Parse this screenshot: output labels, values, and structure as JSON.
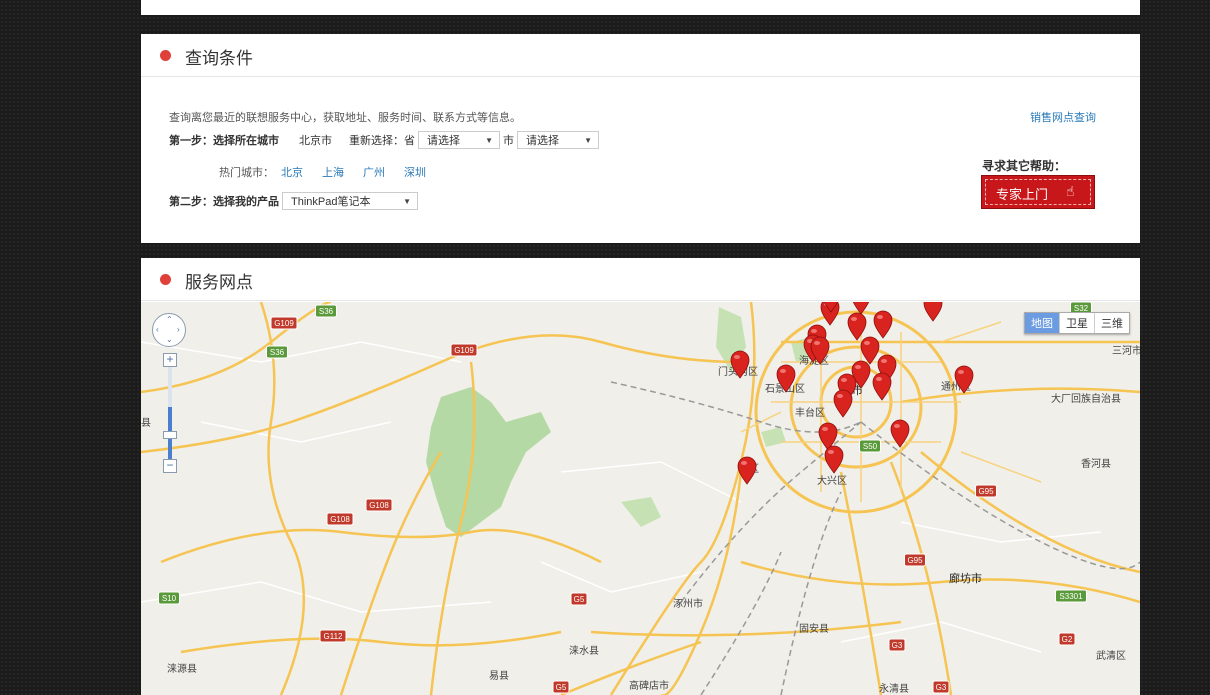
{
  "query": {
    "title": "查询条件",
    "intro": "查询离您最近的联想服务中心，获取地址、服务时间、联系方式等信息。",
    "sales_link": "销售网点查询",
    "step1_label": "第一步：选择所在城市",
    "current_city": "北京市",
    "reselect_label": "重新选择：省",
    "province_select": "请选择",
    "city_label": "市",
    "city_select": "请选择",
    "hot_label": "热门城市：",
    "hot_cities": [
      "北京",
      "上海",
      "广州",
      "深圳"
    ],
    "step2_label": "第二步：选择我的产品",
    "product_select": "ThinkPad笔记本",
    "help_title": "寻求其它帮助：",
    "expert_button": "专家上门"
  },
  "service": {
    "title": "服务网点",
    "map_types": [
      "地图",
      "卫星",
      "三维"
    ],
    "place_labels": [
      "三河市",
      "门头沟区",
      "海淀区",
      "石景山区",
      "丰台区",
      "京市",
      "通州区",
      "大厂回族自治县",
      "山区",
      "大兴区",
      "香河县",
      "廊坊市",
      "涿州市",
      "涞水县",
      "固安县",
      "永清县",
      "高碑店市",
      "易县",
      "涞源县",
      "武清区",
      "县"
    ],
    "road_shields": [
      "G109",
      "S36",
      "S36",
      "G109",
      "G108",
      "G108",
      "S10",
      "G112",
      "G5",
      "S50",
      "G95",
      "G95",
      "G3",
      "G2",
      "S3301",
      "S32",
      "G3",
      "G5"
    ]
  },
  "colors": {
    "accent": "#e0403a",
    "link": "#2a7ab8",
    "expert_button": "#c8171a",
    "marker": "#d9231f",
    "road_major": "#f5c453",
    "green_area": "#b5d9a5",
    "map_bg": "#f1efe9"
  }
}
